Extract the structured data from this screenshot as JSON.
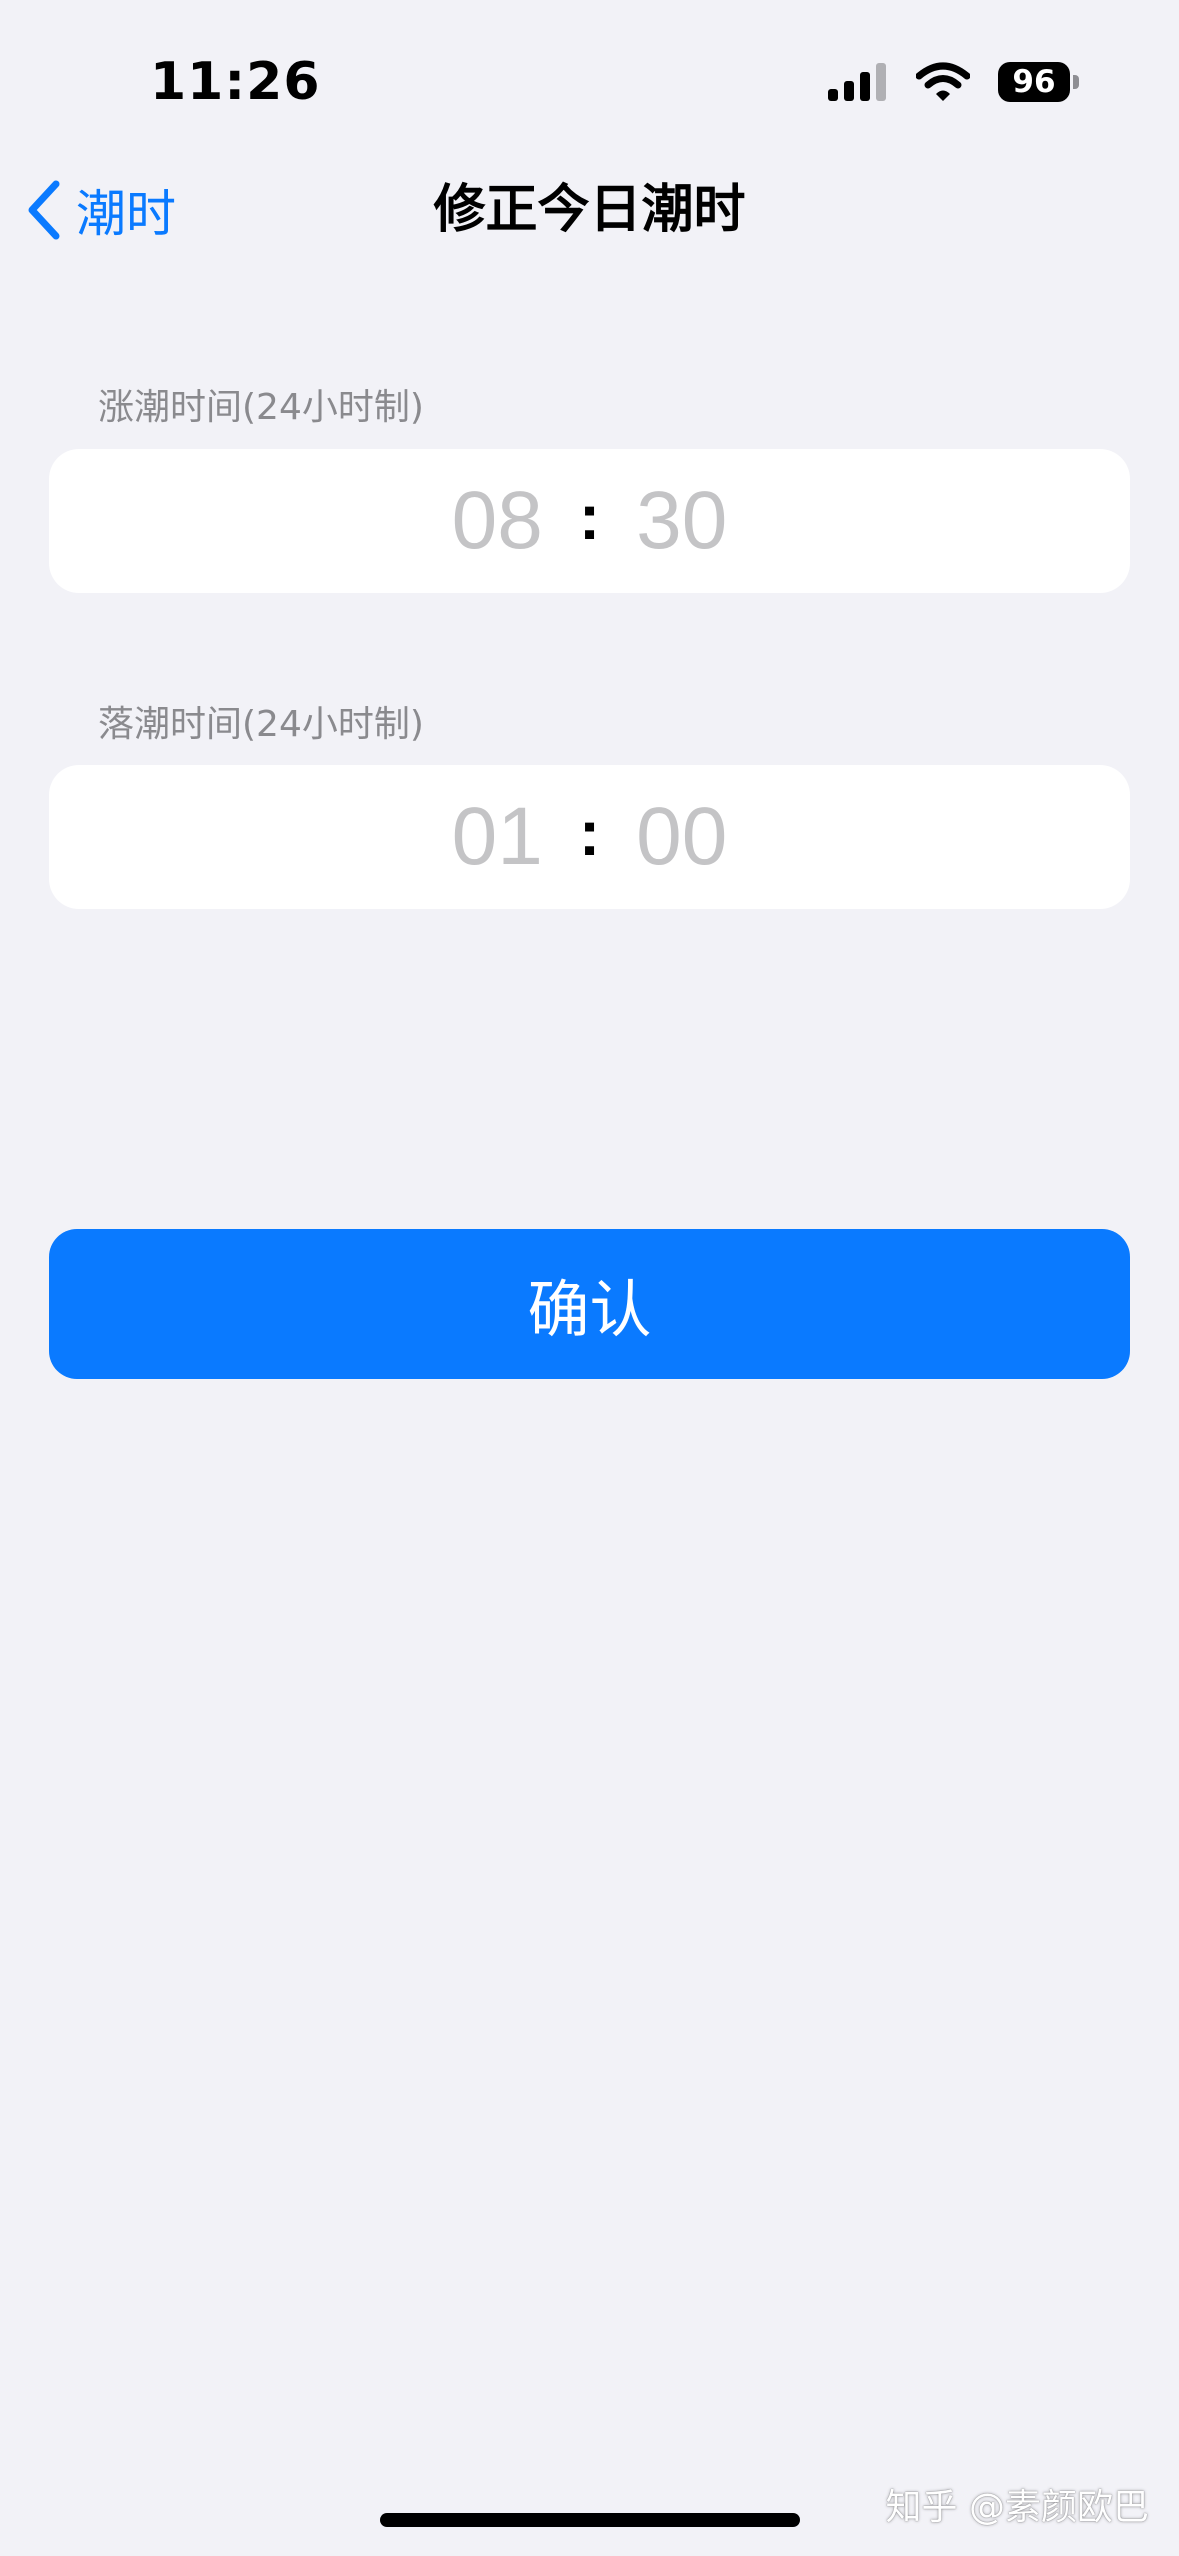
{
  "status_bar": {
    "time": "11:26",
    "battery_level": "96",
    "icons": [
      "cellular-signal-icon",
      "wifi-icon",
      "battery-icon"
    ]
  },
  "nav": {
    "back_label": "潮时",
    "title": "修正今日潮时"
  },
  "high_tide": {
    "label": "涨潮时间(24小时制)",
    "hour": "08",
    "separator": ":",
    "minute": "30"
  },
  "low_tide": {
    "label": "落潮时间(24小时制)",
    "hour": "01",
    "separator": ":",
    "minute": "00"
  },
  "confirm_label": "确认",
  "watermark": "知乎 @素颜欧巴",
  "colors": {
    "accent": "#0a7aff",
    "background": "#f2f2f7",
    "placeholder": "#c4c4c6",
    "label": "#8a8a8e"
  }
}
